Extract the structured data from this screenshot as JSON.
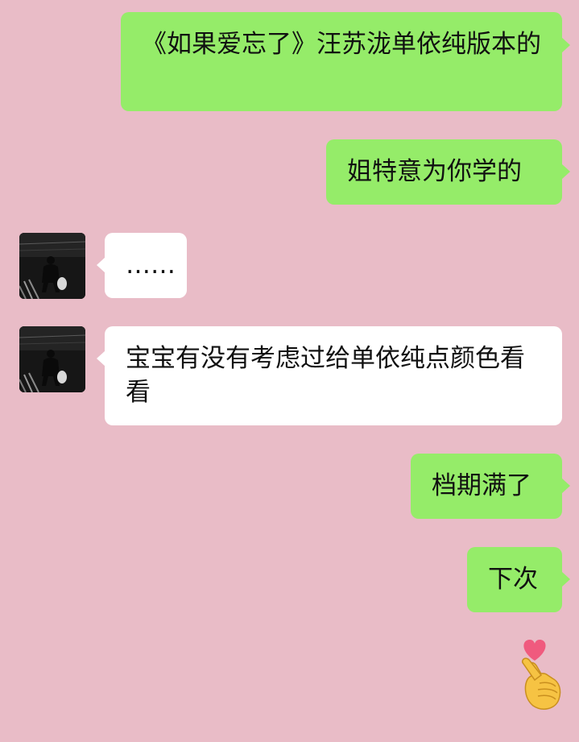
{
  "messages": [
    {
      "side": "out",
      "text": "《如果爱忘了》汪苏泷单依纯版本的"
    },
    {
      "side": "out",
      "text": "姐特意为你学的"
    },
    {
      "side": "in",
      "text": "……"
    },
    {
      "side": "in",
      "text": "宝宝有没有考虑过给单依纯点颜色看看"
    },
    {
      "side": "out",
      "text": "档期满了"
    },
    {
      "side": "out",
      "text": "下次"
    }
  ],
  "sticker": {
    "icon": "finger-heart-icon"
  },
  "colors": {
    "background": "#e9bcc7",
    "outgoing_bubble": "#95ec69",
    "incoming_bubble": "#ffffff"
  }
}
